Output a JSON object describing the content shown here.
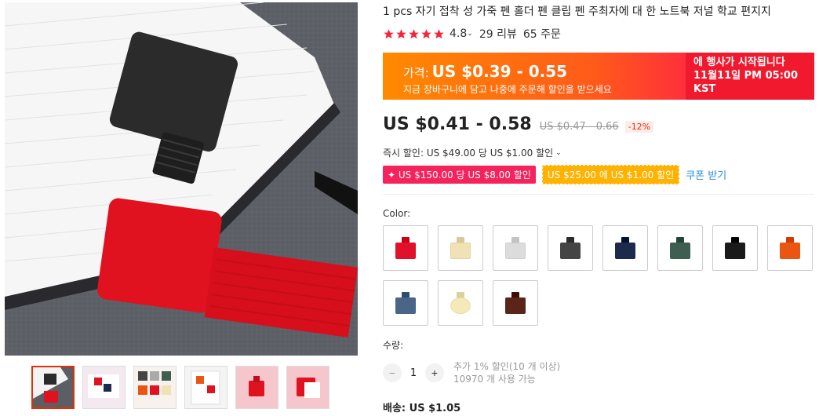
{
  "product": {
    "title": "1 pcs 자기 접착 성 가죽 펜 홀더 펜 클립 펜 주최자에 대 한 노트북 저널 학교 편지지",
    "rating": "4.8",
    "reviews": "29 리뷰",
    "orders": "65 주문"
  },
  "promo": {
    "price_label": "가격:",
    "price": "US $0.39 - 0.55",
    "subtext": "지금 장바구니에 담고 나중에 주문해 할인을 받으세요",
    "event_line1": "에 행사가 시작됩니다",
    "event_line2": "11월11일 PM 05:00",
    "event_line3": "KST"
  },
  "price": {
    "current": "US $0.41 - 0.58",
    "original": "US $0.47 - 0.66",
    "discount": "-12%"
  },
  "instant_discount": "즉시 할인: US $49.00 당 US $1.00 할인",
  "coupons": {
    "coupon_a": "✦ US $150.00 당 US $8.00 할인",
    "coupon_b": "US $25.00 에 US $1.00 할인",
    "get_label": "쿠폰 받기"
  },
  "color_label": "Color:",
  "swatch_colors": [
    "#e0112b",
    "#f0e2b4",
    "#dcdcdc",
    "#444444",
    "#1c2a4c",
    "#3e5e50",
    "#1a1a1a",
    "#ea5512",
    "#4a6587",
    "#f4eab8",
    "#5a2418"
  ],
  "quantity": {
    "label": "수량:",
    "value": "1",
    "info_line1": "추가 1% 할인(10 개 이상)",
    "info_line2": "10970 개 사용 가능"
  },
  "shipping": "배송: US $1.05",
  "colors": {
    "accent": "#e62e04",
    "star": "#f5263a",
    "link": "#2c8fd6"
  }
}
